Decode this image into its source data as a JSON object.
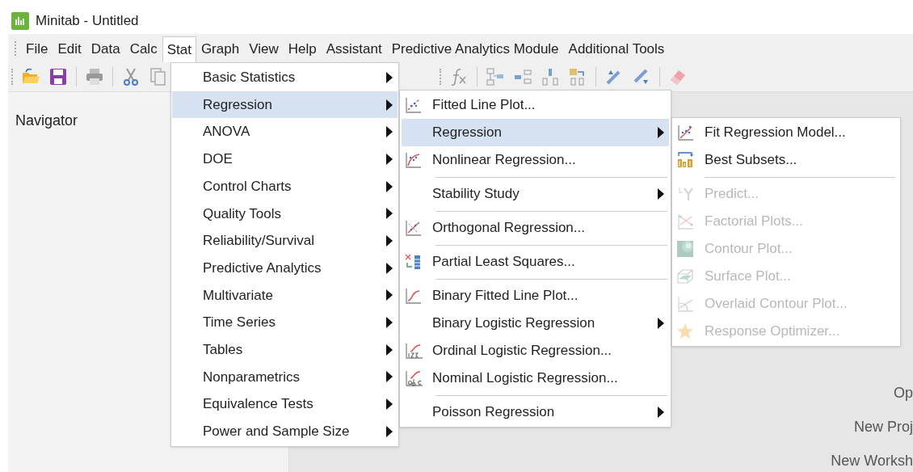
{
  "window": {
    "title": "Minitab - Untitled"
  },
  "menu_bar": [
    {
      "label": "File",
      "selected": false
    },
    {
      "label": "Edit",
      "selected": false
    },
    {
      "label": "Data",
      "selected": false
    },
    {
      "label": "Calc",
      "selected": false
    },
    {
      "label": "Stat",
      "selected": true
    },
    {
      "label": "Graph",
      "selected": false
    },
    {
      "label": "View",
      "selected": false
    },
    {
      "label": "Help",
      "selected": false
    },
    {
      "label": "Assistant",
      "selected": false
    },
    {
      "label": "Predictive Analytics Module",
      "selected": false
    },
    {
      "label": "Additional Tools",
      "selected": false
    }
  ],
  "navigator": {
    "title": "Navigator"
  },
  "start_page": [
    "Op",
    "New Proj",
    "New Worksh"
  ],
  "stat_menu": [
    {
      "label": "Basic Statistics",
      "submenu": true,
      "selected": false
    },
    {
      "label": "Regression",
      "submenu": true,
      "selected": true
    },
    {
      "label": "ANOVA",
      "submenu": true,
      "selected": false
    },
    {
      "label": "DOE",
      "submenu": true,
      "selected": false
    },
    {
      "label": "Control Charts",
      "submenu": true,
      "selected": false
    },
    {
      "label": "Quality Tools",
      "submenu": true,
      "selected": false
    },
    {
      "label": "Reliability/Survival",
      "submenu": true,
      "selected": false
    },
    {
      "label": "Predictive Analytics",
      "submenu": true,
      "selected": false
    },
    {
      "label": "Multivariate",
      "submenu": true,
      "selected": false
    },
    {
      "label": "Time Series",
      "submenu": true,
      "selected": false
    },
    {
      "label": "Tables",
      "submenu": true,
      "selected": false
    },
    {
      "label": "Nonparametrics",
      "submenu": true,
      "selected": false
    },
    {
      "label": "Equivalence Tests",
      "submenu": true,
      "selected": false
    },
    {
      "label": "Power and Sample Size",
      "submenu": true,
      "selected": false
    }
  ],
  "regression_menu": [
    {
      "kind": "item",
      "label": "Fitted Line Plot...",
      "submenu": false,
      "selected": false
    },
    {
      "kind": "item",
      "label": "Regression",
      "submenu": true,
      "selected": true
    },
    {
      "kind": "item",
      "label": "Nonlinear Regression...",
      "submenu": false,
      "selected": false
    },
    {
      "kind": "separator"
    },
    {
      "kind": "item",
      "label": "Stability Study",
      "submenu": true,
      "selected": false
    },
    {
      "kind": "separator"
    },
    {
      "kind": "item",
      "label": "Orthogonal Regression...",
      "submenu": false,
      "selected": false
    },
    {
      "kind": "separator"
    },
    {
      "kind": "item",
      "label": "Partial Least Squares...",
      "submenu": false,
      "selected": false
    },
    {
      "kind": "separator"
    },
    {
      "kind": "item",
      "label": "Binary Fitted Line Plot...",
      "submenu": false,
      "selected": false
    },
    {
      "kind": "item",
      "label": "Binary Logistic Regression",
      "submenu": true,
      "selected": false
    },
    {
      "kind": "item",
      "label": "Ordinal Logistic Regression...",
      "submenu": false,
      "selected": false
    },
    {
      "kind": "item",
      "label": "Nominal Logistic Regression...",
      "submenu": false,
      "selected": false
    },
    {
      "kind": "separator"
    },
    {
      "kind": "item",
      "label": "Poisson Regression",
      "submenu": true,
      "selected": false
    }
  ],
  "regression_submenu": [
    {
      "kind": "item",
      "label": "Fit Regression Model...",
      "disabled": false
    },
    {
      "kind": "item",
      "label": "Best Subsets...",
      "disabled": false
    },
    {
      "kind": "separator"
    },
    {
      "kind": "item",
      "label": "Predict...",
      "disabled": true
    },
    {
      "kind": "item",
      "label": "Factorial Plots...",
      "disabled": true
    },
    {
      "kind": "item",
      "label": "Contour Plot...",
      "disabled": true
    },
    {
      "kind": "item",
      "label": "Surface Plot...",
      "disabled": true
    },
    {
      "kind": "item",
      "label": "Overlaid Contour Plot...",
      "disabled": true
    },
    {
      "kind": "item",
      "label": "Response Optimizer...",
      "disabled": true
    }
  ]
}
